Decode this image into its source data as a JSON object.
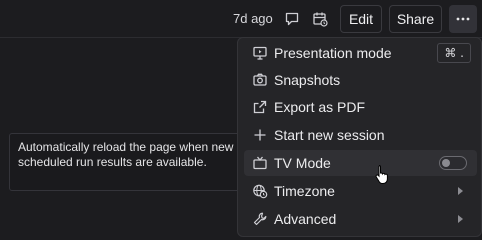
{
  "header": {
    "time_ago": "7d ago",
    "edit_label": "Edit",
    "share_label": "Share"
  },
  "tooltip": {
    "text": "Automatically reload the page when new scheduled run results are available."
  },
  "menu": {
    "items": [
      {
        "label": "Presentation mode",
        "icon": "presentation-icon",
        "shortcut": "⌘ ."
      },
      {
        "label": "Snapshots",
        "icon": "camera-icon"
      },
      {
        "label": "Export as PDF",
        "icon": "export-icon"
      },
      {
        "label": "Start new session",
        "icon": "plus-icon"
      },
      {
        "label": "TV Mode",
        "icon": "tv-icon",
        "toggle": false
      },
      {
        "label": "Timezone",
        "icon": "globe-clock-icon",
        "submenu": true
      },
      {
        "label": "Advanced",
        "icon": "wrench-icon",
        "submenu": true
      }
    ]
  },
  "colors": {
    "background": "#1c1c1f",
    "menu": "#252528",
    "hover": "#303034",
    "text": "#ececee"
  }
}
